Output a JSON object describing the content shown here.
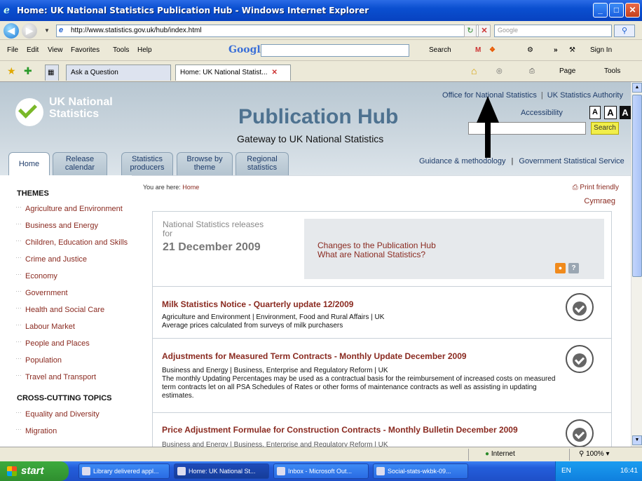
{
  "window": {
    "title": "Home: UK National Statistics Publication Hub - Windows Internet Explorer",
    "minimize": "_",
    "maximize": "□",
    "close": "✕"
  },
  "address_bar": {
    "url": "http://www.statistics.gov.uk/hub/index.html",
    "search_placeholder": "Google"
  },
  "menu": [
    "File",
    "Edit",
    "View",
    "Favorites",
    "Tools",
    "Help"
  ],
  "google_toolbar": {
    "logo": "Google",
    "search_label": "Search",
    "more": "»",
    "sign_in": "Sign In"
  },
  "tabs_bar": {
    "ask_tab": "Ask a Question",
    "active_tab": "Home: UK National Statist...",
    "page_menu": "Page",
    "tools_menu": "Tools"
  },
  "site": {
    "logo_text": "UK National Statistics",
    "title": "Publication Hub",
    "subtitle": "Gateway to UK National Statistics",
    "top_links": [
      "Office for National Statistics",
      "UK Statistics Authority"
    ],
    "accessibility_label": "Accessibility",
    "text_size_buttons": [
      "A",
      "A",
      "A"
    ],
    "search_button": "Search",
    "nav_tabs": [
      {
        "label": "Home"
      },
      {
        "label": "Release calendar"
      },
      {
        "label": "Statistics producers"
      },
      {
        "label": "Browse by theme"
      },
      {
        "label": "Regional statistics"
      }
    ],
    "right_links": [
      "Guidance & methodology",
      "Government Statistical Service"
    ]
  },
  "sidebar": {
    "themes_heading": "THEMES",
    "themes": [
      "Agriculture and Environment",
      "Business and Energy",
      "Children, Education and Skills",
      "Crime and Justice",
      "Economy",
      "Government",
      "Health and Social Care",
      "Labour Market",
      "People and Places",
      "Population",
      "Travel and Transport"
    ],
    "cross_heading": "CROSS-CUTTING TOPICS",
    "cross_topics": [
      "Equality and Diversity",
      "Migration"
    ]
  },
  "content": {
    "breadcrumb_prefix": "You are here:",
    "breadcrumb_link": "Home",
    "print_friendly": "Print friendly",
    "cymraeg": "Cymraeg",
    "releases_label": "National Statistics releases for",
    "releases_date": "21 December 2009",
    "links": [
      "Changes to the Publication Hub",
      "What are National Statistics?"
    ],
    "items": [
      {
        "title": "Milk Statistics Notice - Quarterly update 12/2009",
        "category": "Agriculture and Environment | Environment, Food and Rural Affairs | UK",
        "desc": "Average prices calculated from surveys of milk purchasers"
      },
      {
        "title": "Adjustments for Measured Term Contracts - Monthly Update December 2009",
        "category": "Business and Energy | Business, Enterprise and Regulatory Reform | UK",
        "desc": "The monthly Updating Percentages may be used as a contractual basis for the reimbursement of increased costs on measured term contracts let on all PSA Schedules of Rates or other forms of maintenance contracts as well as assisting in updating estimates."
      },
      {
        "title": "Price Adjustment Formulae for Construction Contracts - Monthly Bulletin December 2009",
        "category": "Business and Energy | Business, Enterprise and Regulatory Reform | UK",
        "desc": ""
      }
    ]
  },
  "status_bar": {
    "zone": "Internet",
    "zoom": "100%"
  },
  "taskbar": {
    "start": "start",
    "tasks": [
      "Library delivered appl...",
      "Home: UK National St...",
      "Inbox - Microsoft Out...",
      "Social-stats-wkbk-09..."
    ],
    "lang": "EN",
    "clock": "16:41"
  }
}
